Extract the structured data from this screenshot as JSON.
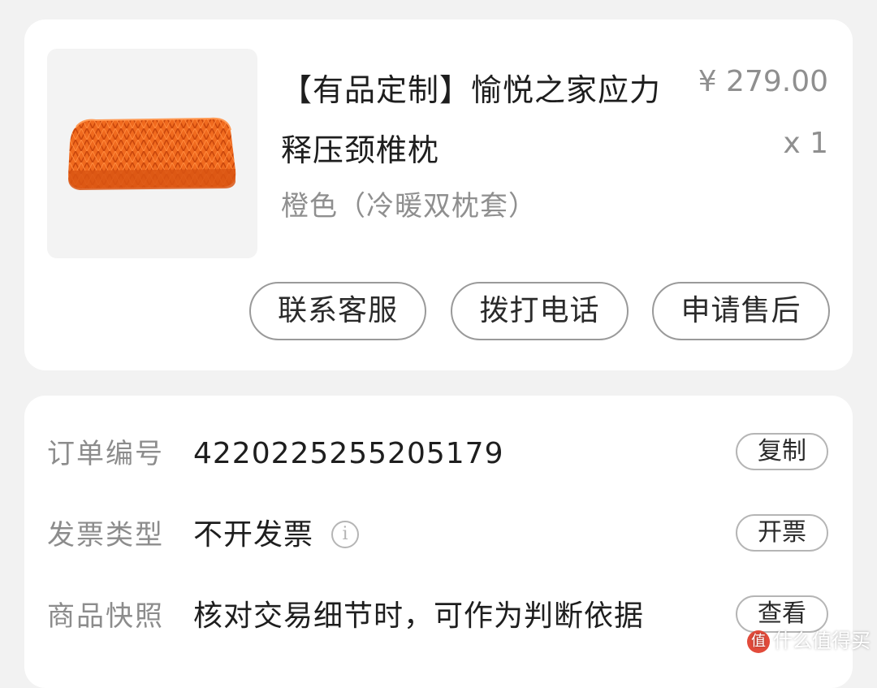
{
  "product": {
    "title": "【有品定制】愉悦之家应力释压颈椎枕",
    "price": "¥ 279.00",
    "quantity": "x 1",
    "variant": "橙色（冷暖双枕套）",
    "image_icon": "orange-pillow",
    "accent_color": "#f26b1f"
  },
  "actions": {
    "contact_service": "联系客服",
    "make_call": "拨打电话",
    "after_sales": "申请售后"
  },
  "order_details": {
    "rows": [
      {
        "label": "订单编号",
        "value": "4220225255205179",
        "button": "复制"
      },
      {
        "label": "发票类型",
        "value": "不开发票",
        "icon": "info-icon",
        "button": "开票"
      },
      {
        "label": "商品快照",
        "value": "核对交易细节时，可作为判断依据",
        "button": "查看"
      }
    ]
  },
  "watermark": {
    "badge": "值",
    "text": "什么值得买"
  }
}
